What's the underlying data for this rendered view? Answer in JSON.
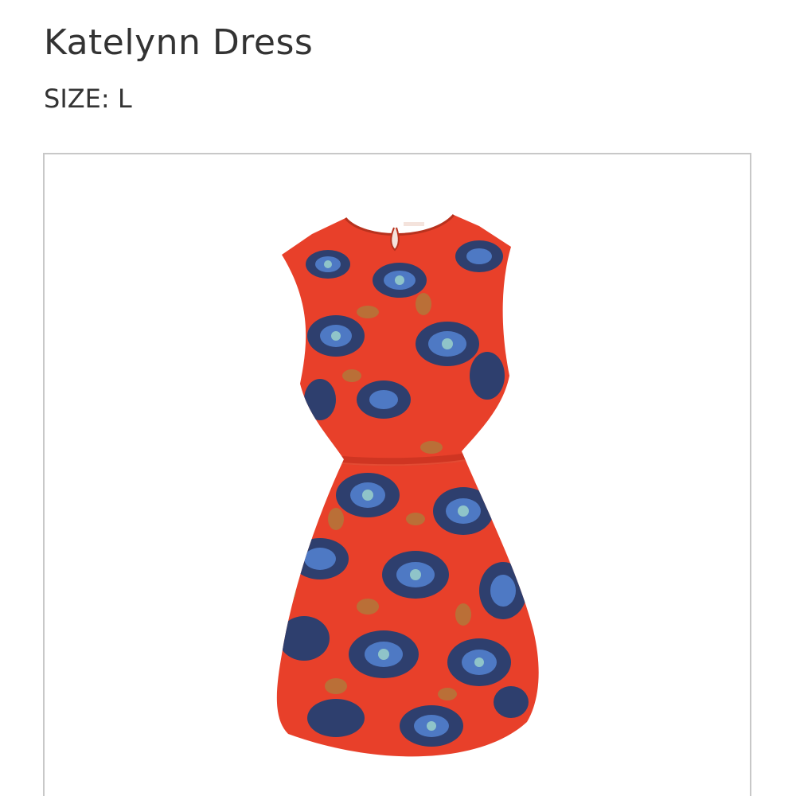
{
  "product": {
    "name": "Katelynn Dress",
    "size_label": "SIZE:",
    "size_value": "L"
  },
  "image": {
    "icon": "dress-photo",
    "colors": {
      "base": "#e8402a",
      "navy": "#2e3f6e",
      "blue": "#4e79c4",
      "teal": "#8fc4c9",
      "gold": "#b2783a"
    }
  }
}
